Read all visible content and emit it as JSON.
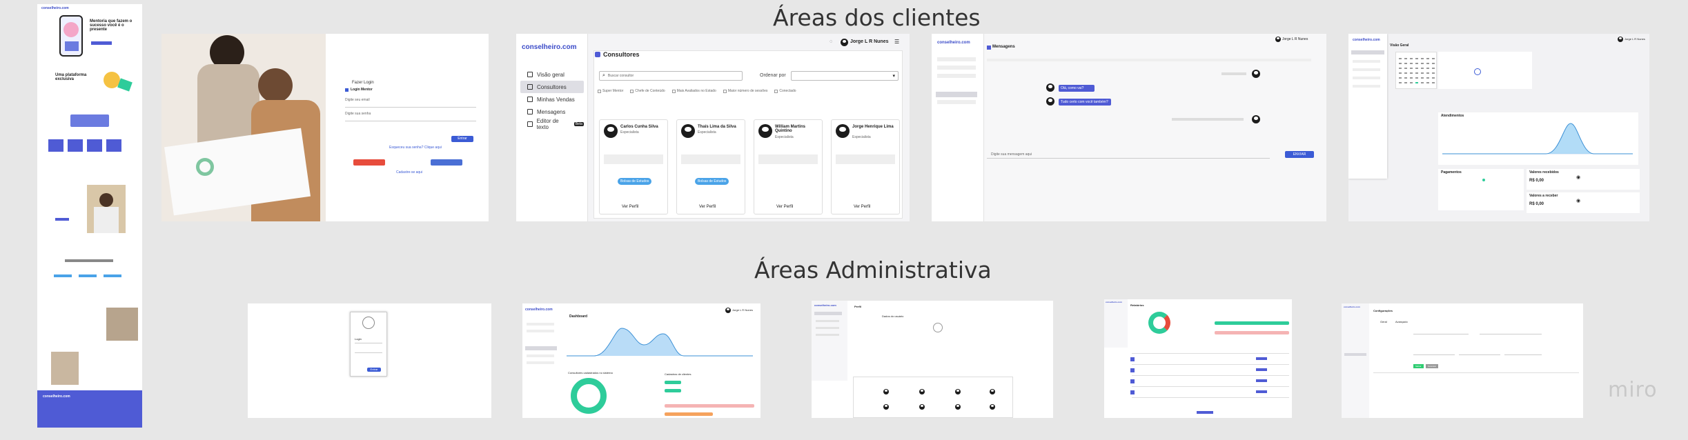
{
  "board": {
    "heading_clients": "Áreas dos clientes",
    "heading_admin": "Áreas Administrativa",
    "watermark": "miro"
  },
  "colors": {
    "brand": "#4f5bd5",
    "teal": "#2ecc9a",
    "pink": "#f5b4b4",
    "orange": "#f5a25d",
    "bg": "#e7e7e7"
  },
  "landing": {
    "logo": "conselheiro.com",
    "hero_title": "Mentoria que fazem o sucesso você é o presente",
    "platform_title": "Uma plataforma exclusiva",
    "footer_logo": "conselheiro.com"
  },
  "login": {
    "title": "Fazer Login",
    "remember": "Login Mentor",
    "email_label": "Digite seu email",
    "password_label": "Digite sua senha",
    "enter": "Entrar",
    "forgot": "Esqueceu sua senha? Clique aqui",
    "register": "Cadastre-se aqui"
  },
  "consultants": {
    "logo": "conselheiro.com",
    "user": "Jorge L R Nunes",
    "title": "Consultores",
    "search_placeholder": "Buscar consultor",
    "order_label": "Ordenar por",
    "filters": [
      "Super Mentor",
      "Chefe de Conteúdo",
      "Mais Avaliados no Estado",
      "Maior número de sessões",
      "Conectado"
    ],
    "nav": [
      "Visão geral",
      "Consultores",
      "Minhas Vendas",
      "Mensagens",
      "Editor de texto"
    ],
    "nav_badge": "Beta",
    "cards": [
      {
        "name": "Carlos Cunha Silva",
        "role": "Especialista",
        "chip": "Bolsas de Estudos",
        "link": "Ver Perfil"
      },
      {
        "name": "Thaís Lima da Silva",
        "role": "Especialista",
        "chip": "Bolsas de Estudos",
        "link": "Ver Perfil"
      },
      {
        "name": "William Martins Quintino",
        "role": "Especialista",
        "chip": "",
        "link": "Ver Perfil"
      },
      {
        "name": "Jorge Henrique Lima",
        "role": "Especialista",
        "chip": "",
        "link": "Ver Perfil"
      }
    ]
  },
  "messages": {
    "logo": "conselheiro.com",
    "user": "Jorge L R Nunes",
    "title": "Mensagens",
    "input_placeholder": "Digite sua mensagem aqui",
    "send": "ENVIAR",
    "msg1": "Olá, como vai?",
    "msg2": "Tudo certo com você também?"
  },
  "overview": {
    "logo": "conselheiro.com",
    "user": "Jorge L R Nunes",
    "title": "Visão Geral",
    "chart_title": "Atendimentos",
    "payments": "Pagamentos",
    "received": "Valores recebidos",
    "value1": "R$ 0,00",
    "to_receive": "Valores a receber",
    "value2": "R$ 0,00"
  },
  "admin_login": {
    "title": "Login",
    "button": "Entrar"
  },
  "admin_dashboard": {
    "logo": "conselheiro.com",
    "user": "Jorge L R Nunes",
    "title": "Dashboard",
    "donut_label": "Consultores cadastrados no sistema",
    "bars_label": "Cadastros de clientes"
  },
  "admin_profile": {
    "logo": "conselheiro.com",
    "title": "Perfil",
    "subtitle": "Dados do usuário"
  },
  "admin_reports": {
    "logo": "conselheiro.com",
    "title": "Relatórios"
  },
  "admin_settings": {
    "logo": "conselheiro.com",
    "title": "Configurações",
    "tabs": [
      "Geral",
      "Avançado"
    ],
    "save": "Salvar",
    "cancel": "Cancelar"
  }
}
